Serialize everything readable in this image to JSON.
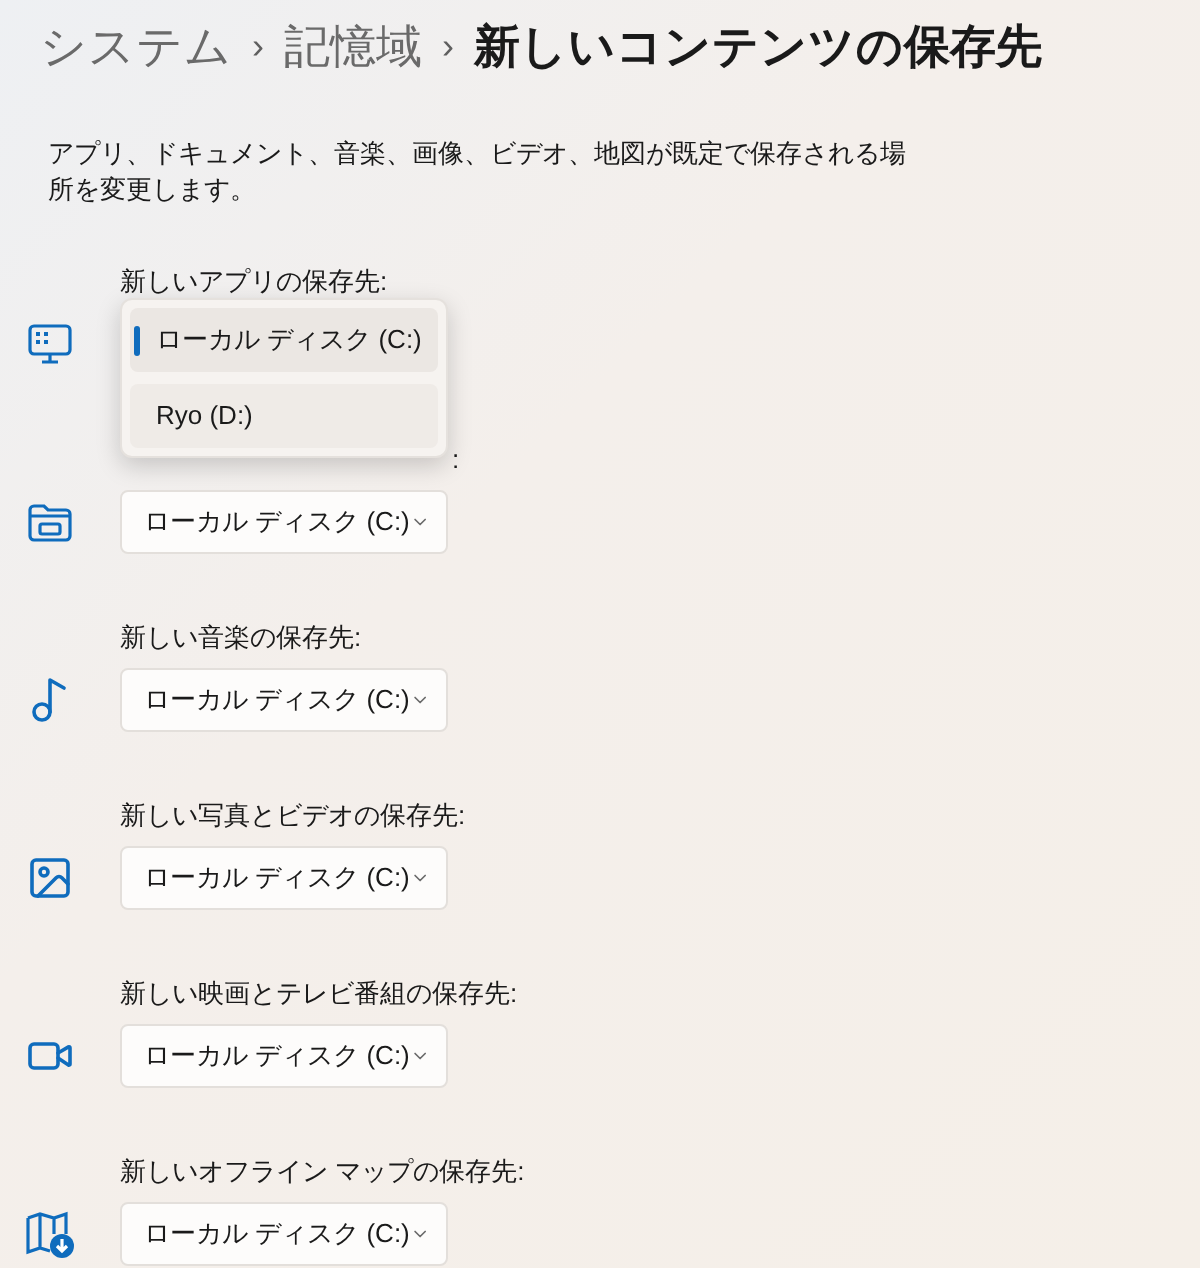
{
  "breadcrumb": [
    {
      "label": "システム",
      "current": false,
      "kind": "link"
    },
    {
      "label": "›",
      "kind": "separator"
    },
    {
      "label": "記憶域",
      "current": false,
      "kind": "link"
    },
    {
      "label": "›",
      "kind": "separator"
    },
    {
      "label": "新しいコンテンツの保存先",
      "current": true,
      "kind": "link"
    }
  ],
  "description": "アプリ、ドキュメント、音楽、画像、ビデオ、地図が既定で保存される場所を変更します。",
  "rows": [
    {
      "label": "新しいアプリの保存先:",
      "open": true,
      "options": [
        {
          "label": "ローカル ディスク (C:)",
          "selected": true
        },
        {
          "label": "Ryo (D:)",
          "selected": false
        }
      ]
    },
    {
      "label": ":",
      "value": "ローカル ディスク (C:)",
      "open": false
    },
    {
      "label": "新しい音楽の保存先:",
      "value": "ローカル ディスク (C:)",
      "open": false
    },
    {
      "label": "新しい写真とビデオの保存先:",
      "value": "ローカル ディスク (C:)",
      "open": false
    },
    {
      "label": "新しい映画とテレビ番組の保存先:",
      "value": "ローカル ディスク (C:)",
      "open": false
    },
    {
      "label": "新しいオフライン マップの保存先:",
      "value": "ローカル ディスク (C:)",
      "open": false
    }
  ]
}
